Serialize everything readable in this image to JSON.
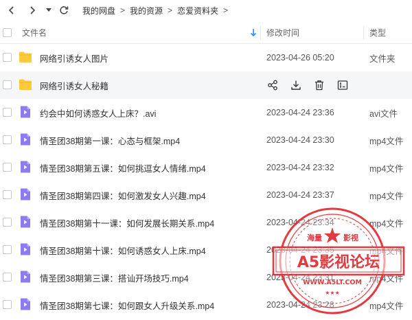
{
  "breadcrumb": {
    "items": [
      "我的网盘",
      "我的资源",
      "恋爱资料夹"
    ],
    "separator": ">"
  },
  "header": {
    "name": "文件名",
    "time": "修改时间",
    "type": "类型"
  },
  "hover_actions": [
    "share-icon",
    "download-icon",
    "delete-icon",
    "rename-icon"
  ],
  "files": [
    {
      "name": "网络引诱女人图片",
      "time": "2023-04-26 05:20",
      "type": "文件夹",
      "icon": "folder-icon"
    },
    {
      "name": "网络引诱女人秘籍",
      "time": "",
      "type": "",
      "icon": "folder-icon"
    },
    {
      "name": "约会中如何诱惑女人上床？.avi",
      "time": "2023-04-24 23:36",
      "type": "avi文件",
      "icon": "video-file-icon"
    },
    {
      "name": "情圣团38期第一课：心态与框架.mp4",
      "time": "2023-04-24 23:30",
      "type": "mp4文件",
      "icon": "video-file-icon"
    },
    {
      "name": "情圣团38期第五课：如何挑逗女人情绪.mp4",
      "time": "2023-04-24 23:32",
      "type": "mp4文件",
      "icon": "video-file-icon"
    },
    {
      "name": "情圣团38期第四课：如何激发女人兴趣.mp4",
      "time": "2023-04-24 23:37",
      "type": "mp4文件",
      "icon": "video-file-icon"
    },
    {
      "name": "情圣团38期第十一课：如何发展长期关系.mp4",
      "time": "2023-04-24 23:34",
      "type": "mp4文件",
      "icon": "video-file-icon"
    },
    {
      "name": "情圣团38期第十课：如何诱惑女人上床.mp4",
      "time": "2023-04-24 23:35",
      "type": "mp4文件",
      "icon": "video-file-icon"
    },
    {
      "name": "情圣团38期第三课：搭讪开场技巧.mp4",
      "time": "2023-04-24 23:31",
      "type": "mp4文件",
      "icon": "video-file-icon"
    },
    {
      "name": "情圣团38期第七课：如何跟女人升级关系.mp4",
      "time": "2023-04-24 23:28",
      "type": "mp4文件",
      "icon": "video-file-icon"
    }
  ],
  "watermark": {
    "top_left": "海量",
    "top_right": "影视",
    "main": "A5影视论坛",
    "url": "WWW.A5LT.COM"
  },
  "colors": {
    "folder": "#ffc83d",
    "video": "#8c7cf0",
    "sort_arrow": "#2f8cff",
    "stamp": "#e0252b"
  }
}
